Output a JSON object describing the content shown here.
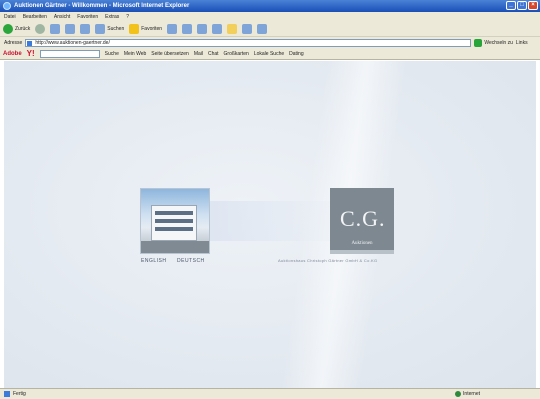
{
  "window": {
    "title": "Auktionen Gärtner - Willkommen - Microsoft Internet Explorer",
    "buttons": [
      "_",
      "□",
      "×"
    ]
  },
  "menu": [
    "Datei",
    "Bearbeiten",
    "Ansicht",
    "Favoriten",
    "Extras",
    "?"
  ],
  "toolbar": {
    "back": "Zurück",
    "search": "Suchen",
    "favorites": "Favoriten"
  },
  "address": {
    "label": "Adresse",
    "url": "http://www.auktionen-gaertner.de/",
    "go": "Wechseln zu",
    "links": "Links"
  },
  "linksbar": {
    "adobe": "Adobe",
    "yahoo": "Y!",
    "search": "Suche",
    "items": [
      "Mein Web",
      "Seite übersetzen",
      "Mail",
      "Chat",
      "Großkarten",
      "Lokale Suche",
      "Dating"
    ]
  },
  "page": {
    "lang_en": "ENGLISH",
    "lang_de": "DEUTSCH",
    "logo_text": "C.G.",
    "logo_sub": "Auktionen",
    "company": "Auktionshaus Christoph Gärtner GmbH & Co.KG"
  },
  "status": {
    "left": "Fertig",
    "zone": "Internet"
  }
}
